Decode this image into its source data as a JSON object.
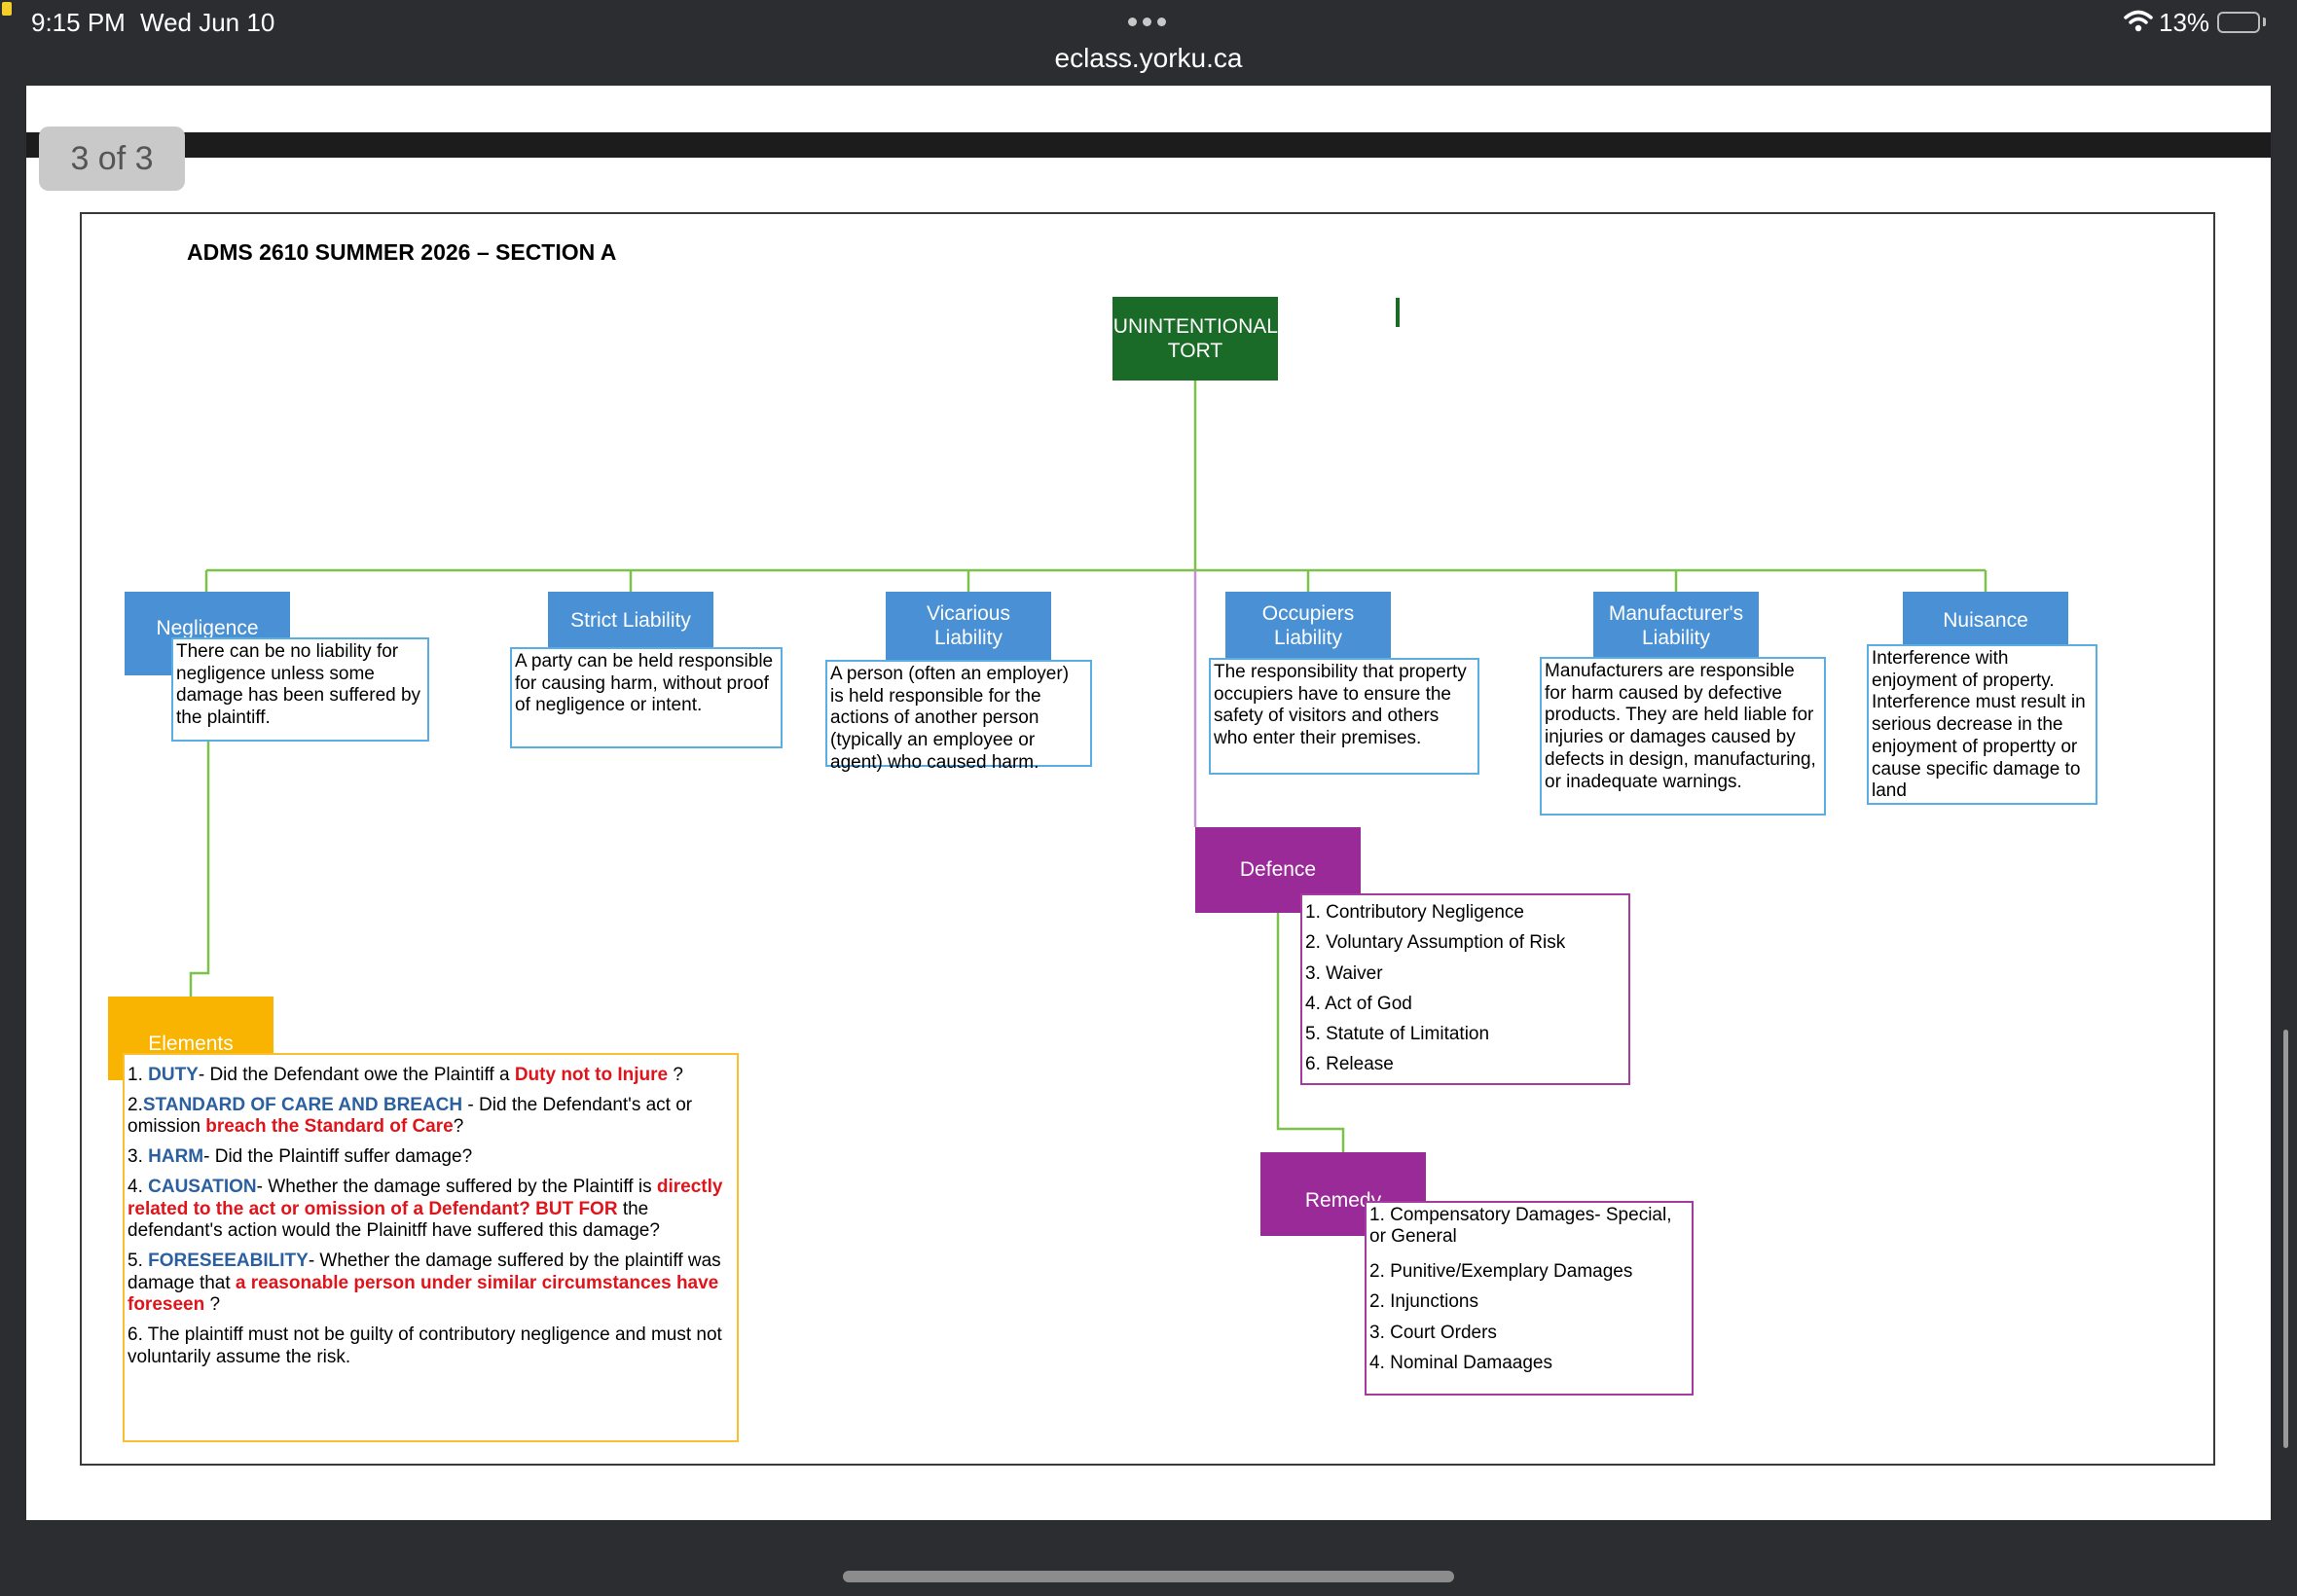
{
  "status_bar": {
    "time": "9:15 PM",
    "date": "Wed Jun 10",
    "url": "eclass.yorku.ca",
    "battery": "13%",
    "battery_level": 0.13
  },
  "viewer": {
    "page_indicator": "3 of 3"
  },
  "document": {
    "title": "ADMS 2610 SUMMER 2026 – SECTION A",
    "root": "UNINTENTIONAL TORT",
    "categories": [
      {
        "label": "Negligence",
        "desc": "There can be no liability for negligence unless some damage has been suffered by the plaintiff."
      },
      {
        "label": "Strict Liability",
        "desc": "A party can be held responsible for causing harm, without proof of negligence or intent."
      },
      {
        "label": "Vicarious Liability",
        "desc": "A person (often an employer) is held responsible for the actions of another person (typically an employee or agent) who caused harm."
      },
      {
        "label": "Occupiers Liability",
        "desc": "The responsibility that property occupiers have to ensure the safety of visitors and others who enter their premises."
      },
      {
        "label": "Manufacturer's Liability",
        "desc": "Manufacturers are responsible for harm caused by defective products. They are held liable for injuries or damages caused by defects in design, manufacturing, or inadequate warnings."
      },
      {
        "label": "Nuisance",
        "desc": "Interference with enjoyment of property. Interference must result in serious decrease in the enjoyment of propertty or cause specific damage to land"
      }
    ],
    "defence": {
      "label": "Defence",
      "items": [
        "1. Contributory Negligence",
        "2. Voluntary Assumption of Risk",
        "3. Waiver",
        "4. Act of God",
        "5. Statute of Limitation",
        "6. Release"
      ]
    },
    "remedy": {
      "label": "Remedy",
      "items": [
        "1. Compensatory Damages- Special,\nor  General",
        "2. Punitive/Exemplary  Damages",
        "2. Injunctions",
        "3. Court Orders",
        "4. Nominal Damaages"
      ]
    },
    "elements": {
      "label": "Elements",
      "items": [
        {
          "p1": "1. ",
          "term": "DUTY",
          "p2": "- Did the Defendant owe the Plaintiff a ",
          "red": "Duty not to Injure",
          "p3": " ?"
        },
        {
          "p1": "2.",
          "term": "STANDARD OF CARE AND BREACH",
          "p2": " - Did the Defendant's act or omission ",
          "red": "breach the Standard of Care",
          "p3": "?"
        },
        {
          "p1": "3. ",
          "term": "HARM",
          "p2": "- Did the Plaintiff suffer damage?",
          "red": "",
          "p3": ""
        },
        {
          "p1": "4. ",
          "term": "CAUSATION",
          "p2": "- Whether the damage suffered by the Plaintiff is ",
          "red": "directly related to the act or omission of a Defendant? BUT FOR",
          "p3": " the defendant's action would the Plainitff have suffered this damage?"
        },
        {
          "p1": "5. ",
          "term": "FORESEEABILITY",
          "p2": "- Whether the damage suffered by the plaintiff was damage that ",
          "red": "a reasonable person under similar circumstances have foreseen",
          "p3": " ?"
        },
        {
          "p1": "6. The plaintiff must not be guilty of contributory negligence and must not voluntarily assume the risk.",
          "term": "",
          "p2": "",
          "red": "",
          "p3": ""
        }
      ]
    }
  },
  "colors": {
    "root": "#1a6b27",
    "category": "#4a90d5",
    "defence_remedy": "#9b2a99",
    "elements": "#f8b400",
    "connector": "#7cc24a"
  }
}
